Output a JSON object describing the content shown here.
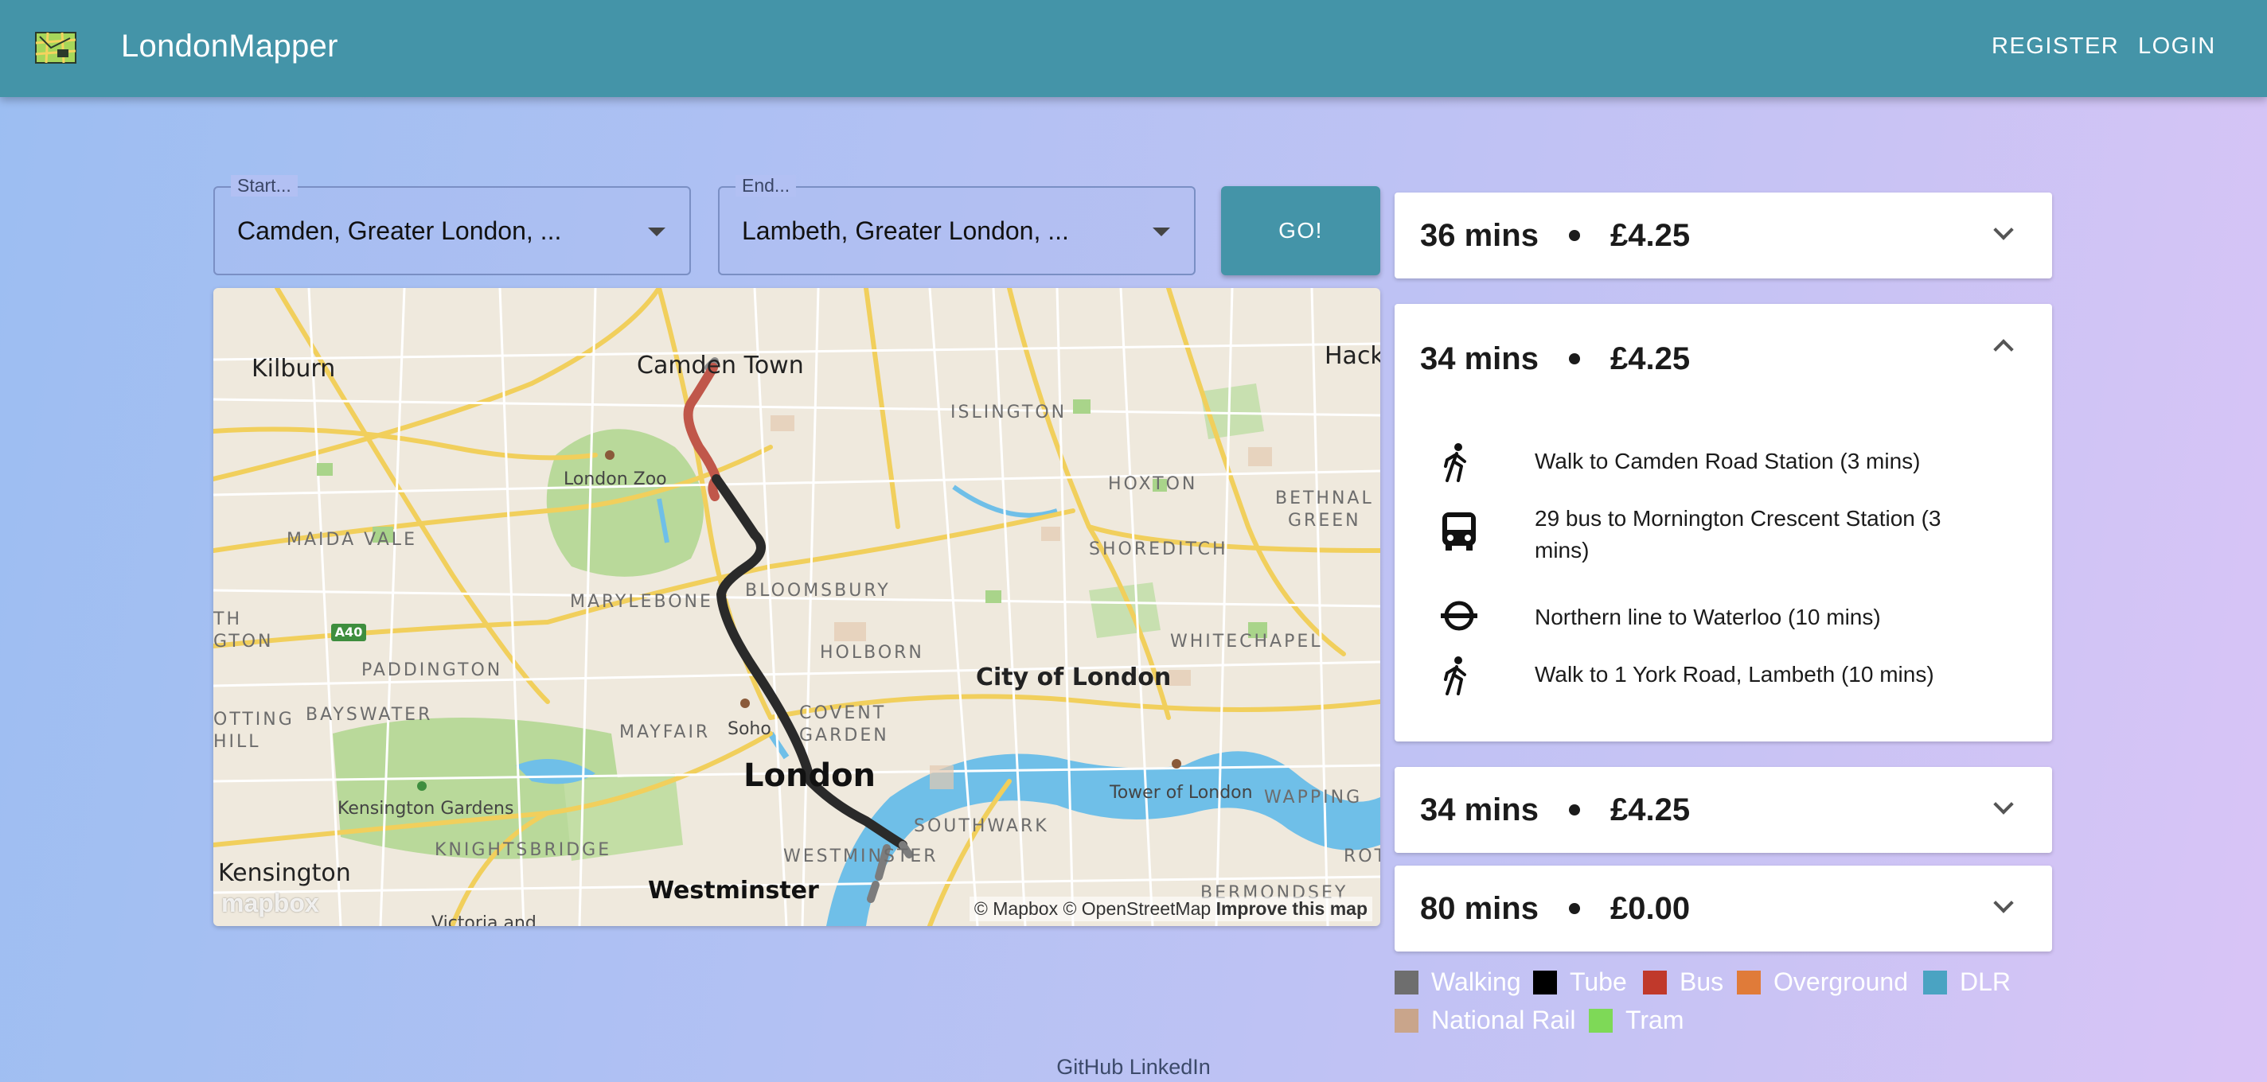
{
  "header": {
    "title": "LondonMapper",
    "register_label": "REGISTER",
    "login_label": "LOGIN",
    "logo_icon": "map-logo-icon",
    "bar_color": "#4494a8"
  },
  "search": {
    "start_label": "Start...",
    "start_value": "Camden, Greater London, ...",
    "end_label": "End...",
    "end_value": "Lambeth, Greater London, ...",
    "go_label": "GO!"
  },
  "map": {
    "labels": {
      "kilburn": "Kilburn",
      "camden_town": "Camden Town",
      "hack": "Hack",
      "london_zoo": "London Zoo",
      "islington": "ISLINGTON",
      "hoxton": "HOXTON",
      "bethnal_green_1": "BETHNAL",
      "bethnal_green_2": "GREEN",
      "maida_vale": "MAIDA VALE",
      "shoreditch": "SHOREDITCH",
      "marylebone": "MARYLEBONE",
      "bloomsbury": "BLOOMSBURY",
      "th": "TH",
      "gton": "GTON",
      "a40": "A40",
      "holborn": "HOLBORN",
      "whitechapel": "WHITECHAPEL",
      "paddington": "PADDINGTON",
      "city_of_london": "City of London",
      "bayswater": "BAYSWATER",
      "otting": "OTTING",
      "hill": "HILL",
      "mayfair": "MAYFAIR",
      "soho": "Soho",
      "covent_1": "COVENT",
      "covent_2": "GARDEN",
      "london": "London",
      "tower_of_london": "Tower of London",
      "wapping": "WAPPING",
      "kensington_gardens": "Kensington Gardens",
      "southwark": "SOUTHWARK",
      "knightsbridge": "KNIGHTSBRIDGE",
      "westminster_dist": "WESTMINSTER",
      "rot": "ROT",
      "kensington": "Kensington",
      "westminster": "Westminster",
      "victoria": "Victoria and",
      "bermondsey": "BERMONDSEY"
    },
    "mapbox_logo": "mapbox",
    "attribution": "© Mapbox © OpenStreetMap",
    "improve_link": "Improve this map"
  },
  "routes": [
    {
      "duration": "36 mins",
      "price": "£4.25",
      "expanded": false
    },
    {
      "duration": "34 mins",
      "price": "£4.25",
      "expanded": true,
      "steps": [
        {
          "icon": "walk-icon",
          "text": "Walk to Camden Road Station (3 mins)"
        },
        {
          "icon": "bus-icon",
          "text": "29 bus to Mornington Crescent Station (3 mins)"
        },
        {
          "icon": "underground-icon",
          "text": "Northern line to Waterloo (10 mins)"
        },
        {
          "icon": "walk-icon",
          "text": "Walk to 1 York Road, Lambeth (10 mins)"
        }
      ]
    },
    {
      "duration": "34 mins",
      "price": "£4.25",
      "expanded": false
    },
    {
      "duration": "80 mins",
      "price": "£0.00",
      "expanded": false
    }
  ],
  "legend": [
    {
      "label": "Walking",
      "color": "#6e6e6e"
    },
    {
      "label": "Tube",
      "color": "#000000"
    },
    {
      "label": "Bus",
      "color": "#c0392b"
    },
    {
      "label": "Overground",
      "color": "#e07b39"
    },
    {
      "label": "DLR",
      "color": "#4aa3c2"
    },
    {
      "label": "National Rail",
      "color": "#c9a58b"
    },
    {
      "label": "Tram",
      "color": "#7ed957"
    }
  ],
  "footer": {
    "text": "GitHub LinkedIn"
  }
}
